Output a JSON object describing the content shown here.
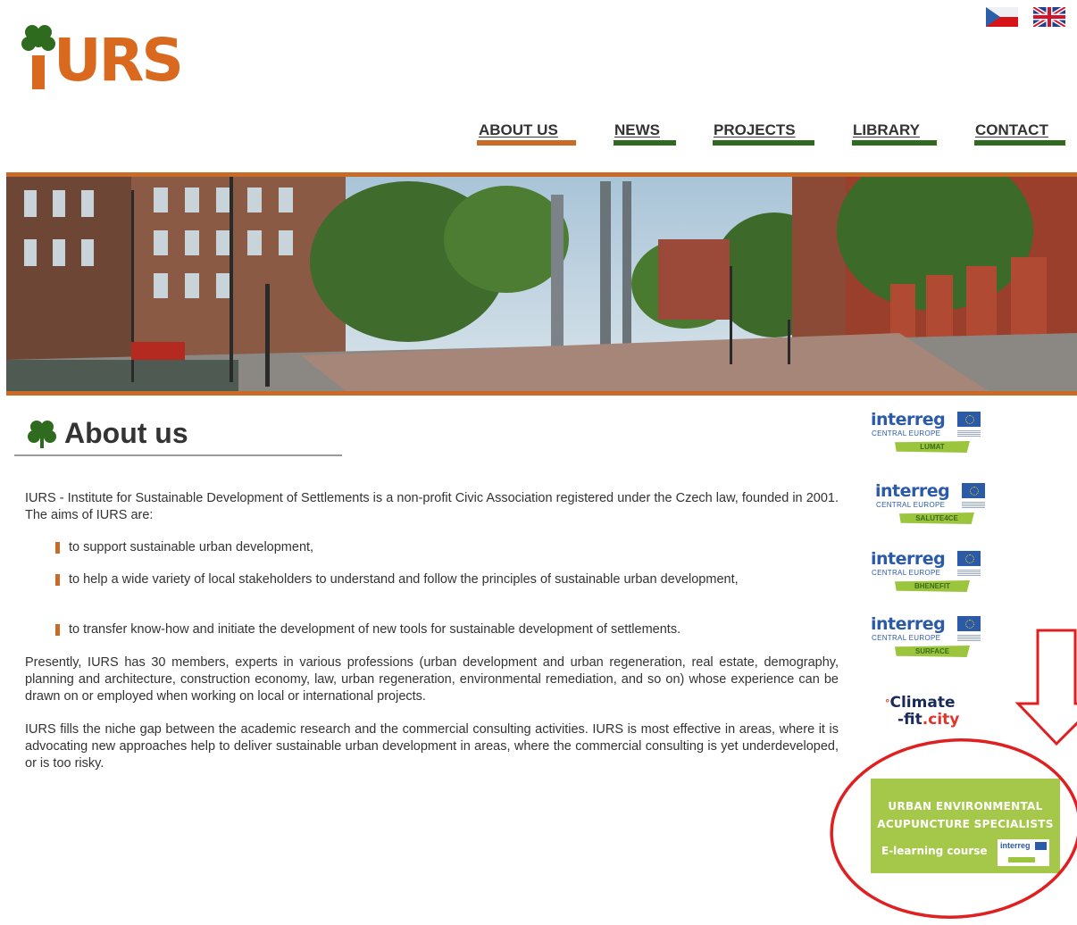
{
  "header": {
    "logo_text": "iURS",
    "languages": [
      {
        "name": "cz-flag-icon",
        "label": "Czech"
      },
      {
        "name": "uk-flag-icon",
        "label": "English"
      }
    ]
  },
  "nav": {
    "items": [
      {
        "label": "ABOUT US",
        "active": true
      },
      {
        "label": "NEWS",
        "active": false
      },
      {
        "label": "PROJECTS",
        "active": false
      },
      {
        "label": "LIBRARY",
        "active": false
      },
      {
        "label": "CONTACT",
        "active": false
      }
    ],
    "active_color": "#c96a27",
    "inactive_color": "#2f6b1e"
  },
  "main": {
    "title": "About us",
    "intro": "IURS - Institute for Sustainable Development of Settlements is a non-profit Civic Association registered under the Czech law, founded in 2001. The aims of IURS are:",
    "aims": [
      "to support sustainable urban development,",
      "to help a wide variety of local stakeholders to understand and follow the principles of sustainable urban development,",
      "to transfer know-how and initiate the development of new tools for sustainable development of settlements."
    ],
    "para2": "Presently, IURS has 30 members, experts in various professions (urban development and urban regeneration, real estate, demography, planning and architecture, construction economy, law, urban regeneration, environmental remediation, and so on) whose experience can be drawn on or employed when working on local or international projects.",
    "para3": "IURS fills the niche gap between the academic research and the commercial consulting activities. IURS is most effective in areas, where it is advocating new approaches help to deliver sustainable urban development  in areas, where the commercial consulting is yet underdeveloped, or is too risky."
  },
  "sidebar": {
    "interreg_word": "interreg",
    "interreg_sub": "CENTRAL EUROPE",
    "projects": [
      "LUMAT",
      "SALUTE4CE",
      "BHENEFIT",
      "SURFACE"
    ],
    "climate": {
      "line1": "Climate",
      "line2a": "-fit",
      "line2b": ".city"
    },
    "elearning": {
      "line1": "URBAN ENVIRONMENTAL",
      "line2": "ACUPUNCTURE SPECIALISTS",
      "course": "E-learning course",
      "mini_word": "interreg"
    }
  },
  "colors": {
    "brand_orange": "#d9691f",
    "nav_green": "#2f6b1e",
    "annotation_red": "#e02020",
    "elearning_green": "#a6c84a"
  }
}
